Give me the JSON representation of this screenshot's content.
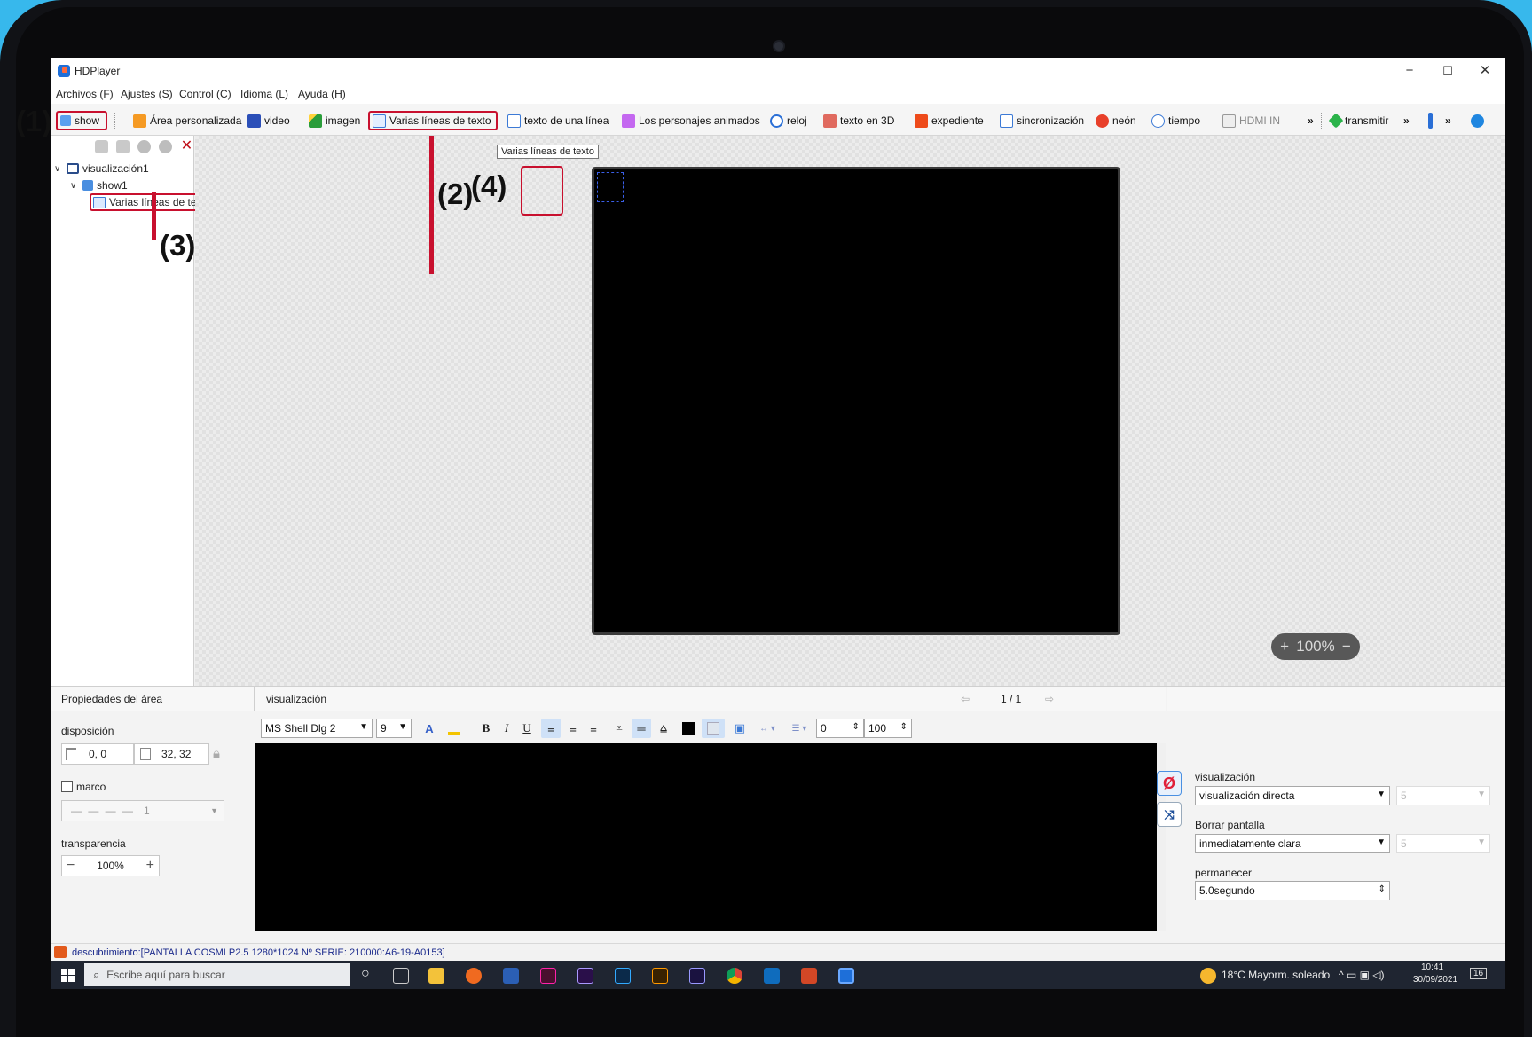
{
  "window": {
    "title": "HDPlayer",
    "minimize": "−",
    "maximize": "☐",
    "close": "✕"
  },
  "menubar": [
    "Archivos (F)",
    "Ajustes (S)",
    "Control (C)",
    "Idioma (L)",
    "Ayuda (H)"
  ],
  "toolbar": {
    "show": "show",
    "area": "Área personalizada",
    "video": "video",
    "imagen": "imagen",
    "multi": "Varias líneas de texto",
    "single": "texto de una línea",
    "animados": "Los personajes animados",
    "reloj": "reloj",
    "texto3d": "texto en 3D",
    "expediente": "expediente",
    "sincronizacion": "sincronización",
    "neon": "neón",
    "tiempo": "tiempo",
    "hdmi": "HDMI IN",
    "more1": "»",
    "transmitir": "transmitir",
    "more2": "»",
    "more3": "»",
    "tooltip": "Varias líneas de texto"
  },
  "tree": {
    "root": "visualización1",
    "show": "show1",
    "item": "Varias líneas de tex..."
  },
  "annotations": {
    "a1": "(1)",
    "a2": "(2)",
    "a3": "(3)",
    "a4": "(4)"
  },
  "canvas": {
    "zoom_plus": "+",
    "zoom_value": "100%",
    "zoom_minus": "−"
  },
  "props": {
    "header": "Propiedades del área",
    "layout_label": "disposición",
    "position": "0, 0",
    "size": "32, 32",
    "border_label": "marco",
    "border_value": "1",
    "transparency_label": "transparencia",
    "transparency_value": "100%",
    "minus": "−",
    "plus": "+"
  },
  "editor": {
    "header": "visualización",
    "page": "1 / 1",
    "font": "MS Shell Dlg 2",
    "font_size": "9",
    "bold": "B",
    "italic": "I",
    "underline": "U",
    "spacing": "0",
    "scale": "100"
  },
  "effects": {
    "display_label": "visualización",
    "display_value": "visualización directa",
    "display_speed": "5",
    "clear_label": "Borrar pantalla",
    "clear_value": "inmediatamente clara",
    "clear_speed": "5",
    "stay_label": "permanecer",
    "stay_value": "5.0segundo"
  },
  "status": "descubrimiento:[PANTALLA COSMI P2.5 1280*1024 Nº SERIE: 210000:A6-19-A0153]",
  "taskbar": {
    "search": "Escribe aquí para buscar",
    "weather": "18°C  Mayorm. soleado",
    "time": "10:41",
    "date": "30/09/2021",
    "notif": "16"
  }
}
